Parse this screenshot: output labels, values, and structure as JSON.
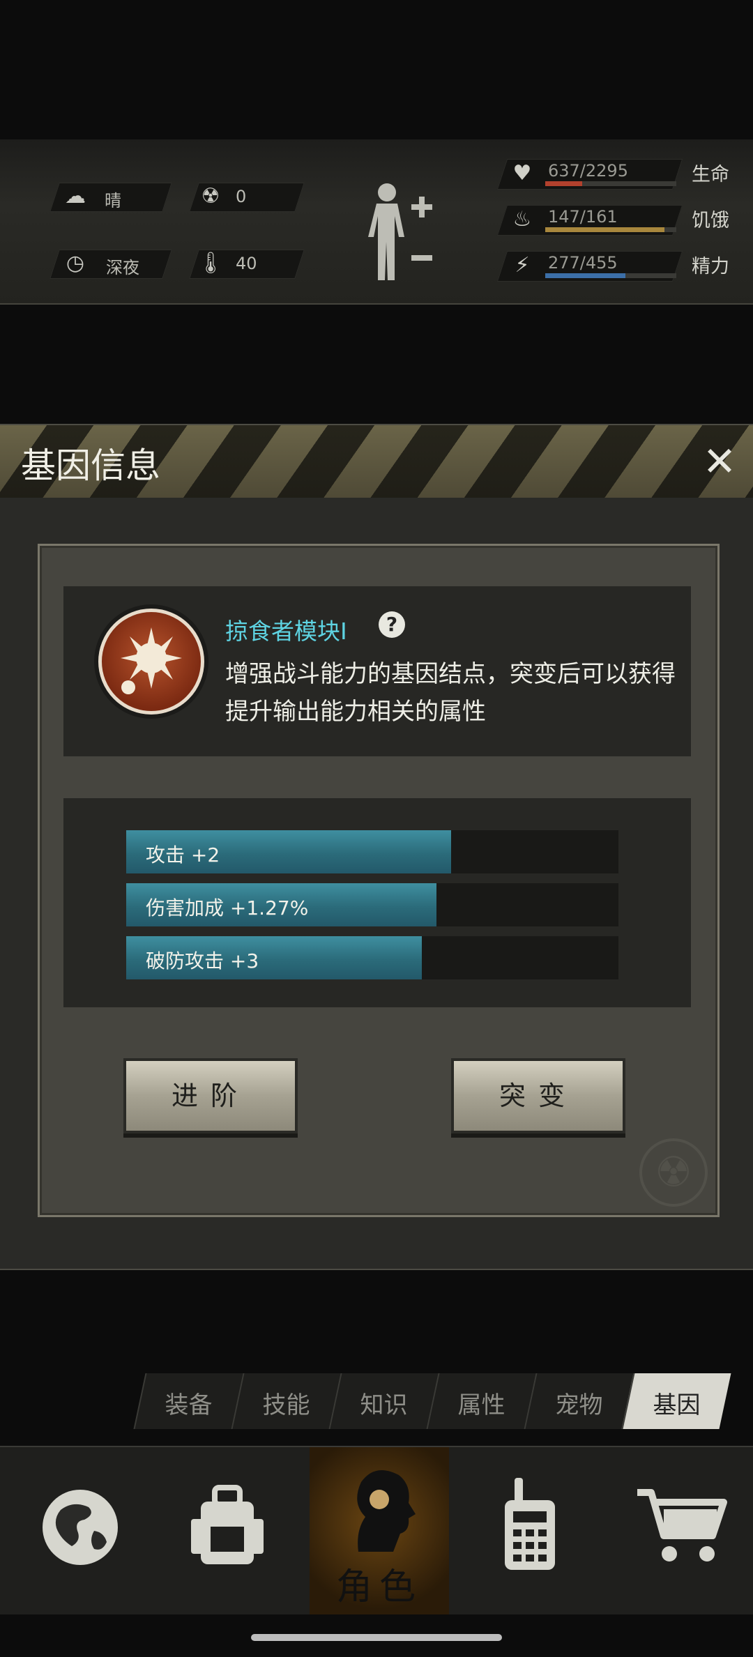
{
  "status": {
    "weather": "晴",
    "radiation": "0",
    "time_of_day": "深夜",
    "temperature": "40",
    "stats": [
      {
        "label": "生命",
        "value": "637/2295",
        "fraction": 0.28,
        "color": "#b3412d",
        "icon": "heart-icon"
      },
      {
        "label": "饥饿",
        "value": "147/161",
        "fraction": 0.91,
        "color": "#a8873d",
        "icon": "stomach-icon"
      },
      {
        "label": "精力",
        "value": "277/455",
        "fraction": 0.61,
        "color": "#3c6fa8",
        "icon": "energy-icon"
      }
    ]
  },
  "modal": {
    "title": "基因信息",
    "close_icon": "close-icon",
    "gene": {
      "name": "掠食者模块Ⅰ",
      "help_icon": "help-icon",
      "description_line1": "增强战斗能力的基因结点，突变后可以获得",
      "description_line2": "提升输出能力相关的属性"
    },
    "attributes": [
      {
        "text": "攻击 +2",
        "fraction": 0.66
      },
      {
        "text": "伤害加成 +1.27%",
        "fraction": 0.63
      },
      {
        "text": "破防攻击 +3",
        "fraction": 0.6
      }
    ],
    "buttons": {
      "advance": "进阶",
      "mutate": "突变"
    }
  },
  "tabs": [
    "装备",
    "技能",
    "知识",
    "属性",
    "宠物",
    "基因"
  ],
  "active_tab": "基因",
  "nav": {
    "items": [
      "globe-icon",
      "backpack-icon",
      "character-icon",
      "radio-icon",
      "cart-icon"
    ],
    "character_label": "角色"
  }
}
